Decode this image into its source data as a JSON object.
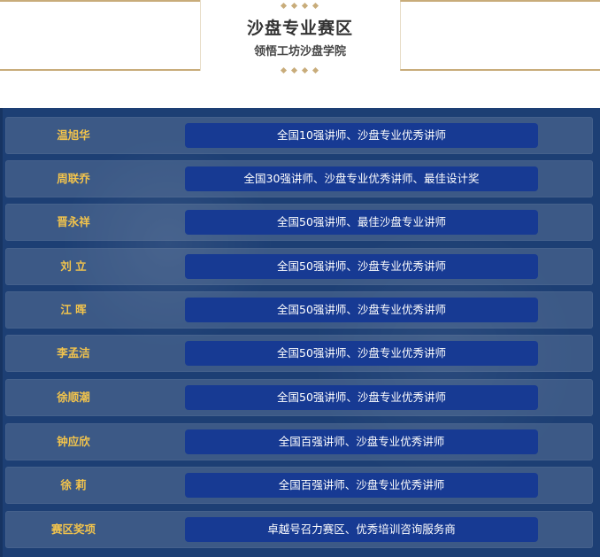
{
  "header": {
    "title": "沙盘专业赛区",
    "subtitle": "领悟工坊沙盘学院"
  },
  "rows": [
    {
      "name": "温旭华",
      "award": "全国10强讲师、沙盘专业优秀讲师"
    },
    {
      "name": "周联乔",
      "award": "全国30强讲师、沙盘专业优秀讲师、最佳设计奖"
    },
    {
      "name": "晋永祥",
      "award": "全国50强讲师、最佳沙盘专业讲师"
    },
    {
      "name": "刘  立",
      "award": "全国50强讲师、沙盘专业优秀讲师"
    },
    {
      "name": "江  晖",
      "award": "全国50强讲师、沙盘专业优秀讲师"
    },
    {
      "name": "李孟洁",
      "award": "全国50强讲师、沙盘专业优秀讲师"
    },
    {
      "name": "徐顺潮",
      "award": "全国50强讲师、沙盘专业优秀讲师"
    },
    {
      "name": "钟应欣",
      "award": "全国百强讲师、沙盘专业优秀讲师"
    },
    {
      "name": "徐  莉",
      "award": "全国百强讲师、沙盘专业优秀讲师"
    },
    {
      "name": "赛区奖项",
      "award": "卓越号召力赛区、优秀培训咨询服务商"
    }
  ],
  "colors": {
    "gold": "#c8ac7a",
    "name_text": "#f3c44c",
    "panel_bg": "#1d3f74",
    "award_bg": "#173a93"
  }
}
